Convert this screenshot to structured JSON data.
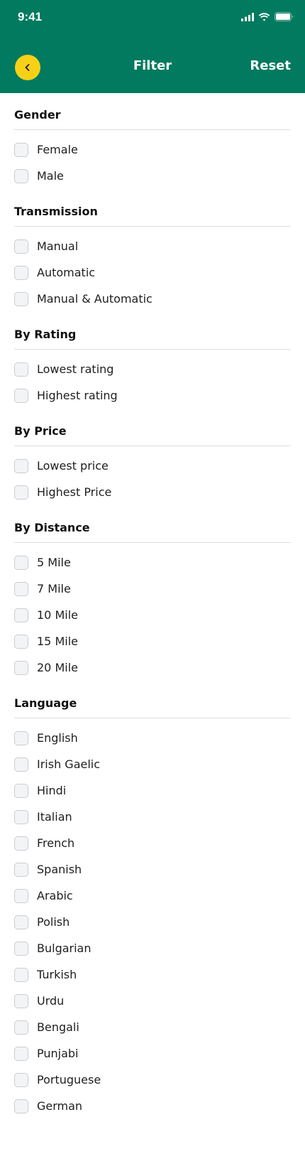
{
  "status": {
    "time": "9:41"
  },
  "header": {
    "title": "Filter",
    "reset_label": "Reset"
  },
  "sections": [
    {
      "title": "Gender",
      "options": [
        "Female",
        "Male"
      ]
    },
    {
      "title": "Transmission",
      "options": [
        "Manual",
        "Automatic",
        "Manual & Automatic"
      ]
    },
    {
      "title": "By Rating",
      "options": [
        "Lowest rating",
        "Highest rating"
      ]
    },
    {
      "title": "By Price",
      "options": [
        "Lowest price",
        "Highest Price"
      ]
    },
    {
      "title": "By Distance",
      "options": [
        "5 Mile",
        "7 Mile",
        "10 Mile",
        "15 Mile",
        "20 Mile"
      ]
    },
    {
      "title": "Language",
      "options": [
        "English",
        "Irish Gaelic",
        "Hindi",
        "Italian",
        "French",
        "Spanish",
        "Arabic",
        "Polish",
        "Bulgarian",
        "Turkish",
        "Urdu",
        "Bengali",
        "Punjabi",
        "Portuguese",
        "German"
      ]
    }
  ],
  "colors": {
    "header_bg": "#017a5f",
    "back_button_bg": "#f7d117"
  },
  "icons": {
    "back": "chevron-left-icon",
    "signal": "signal-icon",
    "wifi": "wifi-icon",
    "battery": "battery-icon"
  }
}
